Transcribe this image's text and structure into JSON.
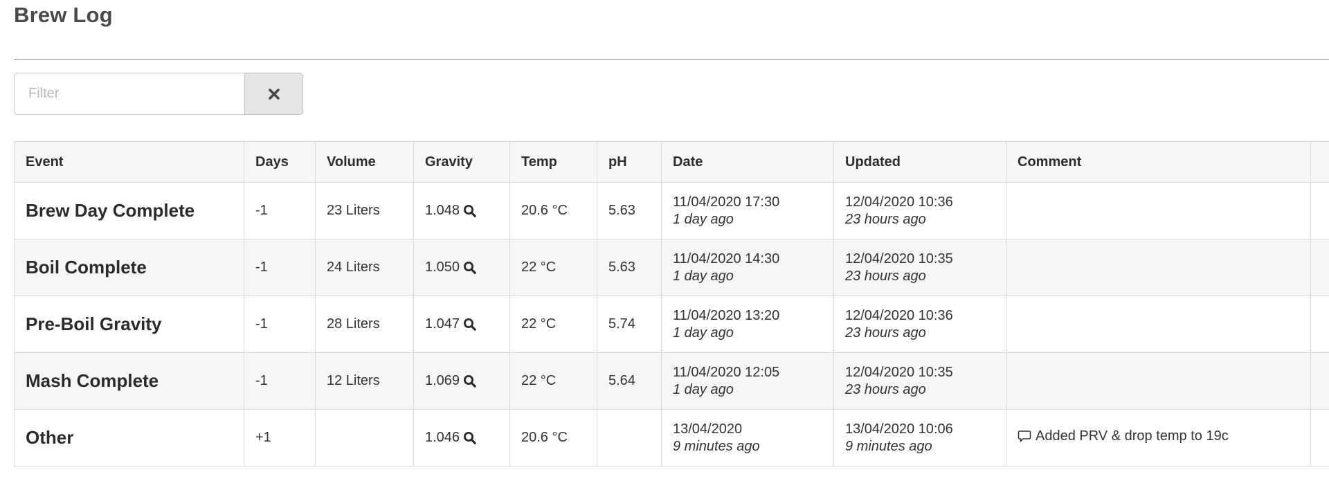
{
  "page": {
    "title": "Brew Log"
  },
  "filter": {
    "placeholder": "Filter",
    "value": "",
    "clear_icon": "close-icon"
  },
  "table": {
    "headers": [
      "Event",
      "Days",
      "Volume",
      "Gravity",
      "Temp",
      "pH",
      "Date",
      "Updated",
      "Comment"
    ],
    "rows": [
      {
        "event": "Brew Day Complete",
        "days": "-1",
        "volume": "23 Liters",
        "gravity": "1.048",
        "temp": "20.6 °C",
        "ph": "5.63",
        "date": "11/04/2020 17:30",
        "date_relative": "1 day ago",
        "updated": "12/04/2020 10:36",
        "updated_relative": "23 hours ago",
        "comment": ""
      },
      {
        "event": "Boil Complete",
        "days": "-1",
        "volume": "24 Liters",
        "gravity": "1.050",
        "temp": "22 °C",
        "ph": "5.63",
        "date": "11/04/2020 14:30",
        "date_relative": "1 day ago",
        "updated": "12/04/2020 10:35",
        "updated_relative": "23 hours ago",
        "comment": ""
      },
      {
        "event": "Pre-Boil Gravity",
        "days": "-1",
        "volume": "28 Liters",
        "gravity": "1.047",
        "temp": "22 °C",
        "ph": "5.74",
        "date": "11/04/2020 13:20",
        "date_relative": "1 day ago",
        "updated": "12/04/2020 10:36",
        "updated_relative": "23 hours ago",
        "comment": ""
      },
      {
        "event": "Mash Complete",
        "days": "-1",
        "volume": "12 Liters",
        "gravity": "1.069",
        "temp": "22 °C",
        "ph": "5.64",
        "date": "11/04/2020 12:05",
        "date_relative": "1 day ago",
        "updated": "12/04/2020 10:35",
        "updated_relative": "23 hours ago",
        "comment": ""
      },
      {
        "event": "Other",
        "days": "+1",
        "volume": "",
        "gravity": "1.046",
        "temp": "20.6 °C",
        "ph": "",
        "date": "13/04/2020",
        "date_relative": "9 minutes ago",
        "updated": "13/04/2020 10:06",
        "updated_relative": "9 minutes ago",
        "comment": "Added PRV & drop temp to 19c"
      }
    ]
  },
  "icons": {
    "gravity": "search-icon",
    "comment": "comment-icon"
  }
}
